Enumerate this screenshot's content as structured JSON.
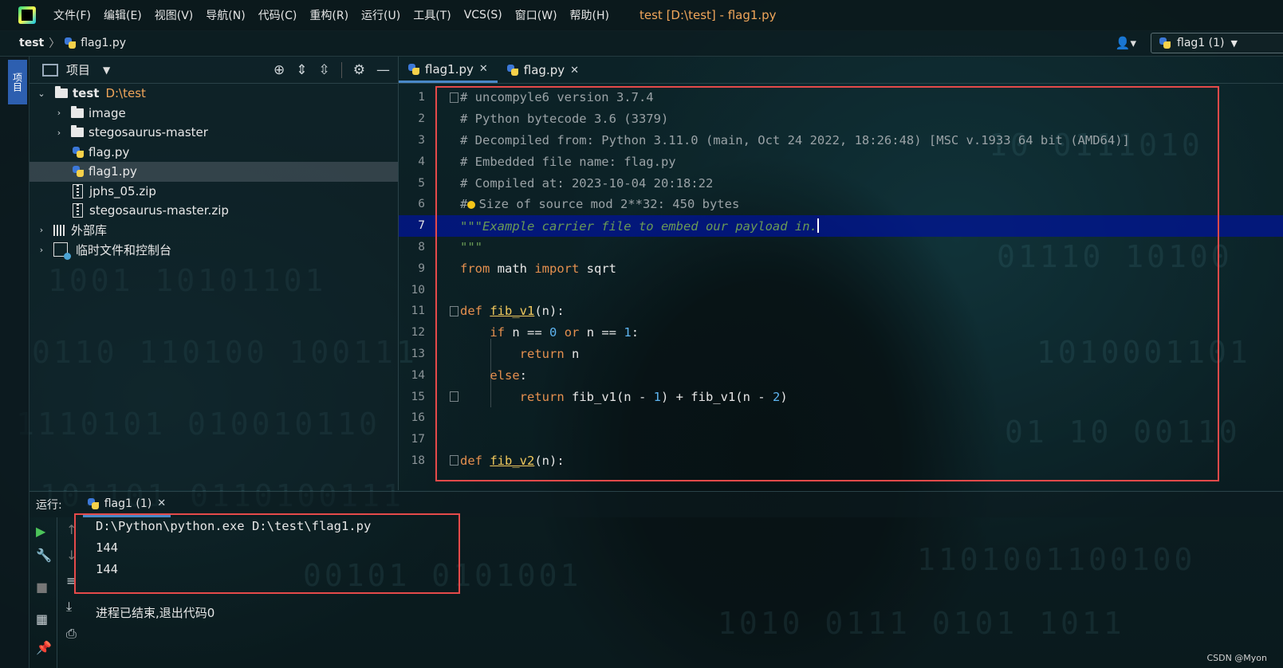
{
  "menubar": {
    "items": [
      "文件(F)",
      "编辑(E)",
      "视图(V)",
      "导航(N)",
      "代码(C)",
      "重构(R)",
      "运行(U)",
      "工具(T)",
      "VCS(S)",
      "窗口(W)",
      "帮助(H)"
    ],
    "window_title": "test [D:\\test] - flag1.py"
  },
  "navbar": {
    "root": "test",
    "file": "flag1.py",
    "run_config": "flag1 (1)"
  },
  "left_stripe": {
    "project_tab": "项目"
  },
  "project_panel": {
    "title": "项目",
    "tree": [
      {
        "label": "test",
        "hint": "D:\\test",
        "type": "root"
      },
      {
        "label": "image",
        "type": "folder"
      },
      {
        "label": "stegosaurus-master",
        "type": "folder"
      },
      {
        "label": "flag.py",
        "type": "py"
      },
      {
        "label": "flag1.py",
        "type": "py",
        "selected": true
      },
      {
        "label": "jphs_05.zip",
        "type": "zip"
      },
      {
        "label": "stegosaurus-master.zip",
        "type": "zip"
      },
      {
        "label": "外部库",
        "type": "lib"
      },
      {
        "label": "临时文件和控制台",
        "type": "scratch"
      }
    ]
  },
  "editor": {
    "tabs": [
      {
        "label": "flag1.py",
        "active": true
      },
      {
        "label": "flag.py",
        "active": false
      }
    ],
    "current_line": 7,
    "lines": [
      {
        "n": "1",
        "code": "# uncompyle6 version 3.7.4"
      },
      {
        "n": "2",
        "code": "# Python bytecode 3.6 (3379)"
      },
      {
        "n": "3",
        "code": "# Decompiled from: Python 3.11.0 (main, Oct 24 2022, 18:26:48) [MSC v.1933 64 bit (AMD64)]"
      },
      {
        "n": "4",
        "code": "# Embedded file name: flag.py"
      },
      {
        "n": "5",
        "code": "# Compiled at: 2023-10-04 20:18:22"
      },
      {
        "n": "6",
        "code": "# Size of source mod 2**32: 450 bytes"
      },
      {
        "n": "7",
        "code": "\"\"\"Example carrier file to embed our payload in."
      },
      {
        "n": "8",
        "code": "\"\"\""
      },
      {
        "n": "9",
        "code": "from math import sqrt"
      },
      {
        "n": "10",
        "code": ""
      },
      {
        "n": "11",
        "code": "def fib_v1(n):"
      },
      {
        "n": "12",
        "code": "    if n == 0 or n == 1:"
      },
      {
        "n": "13",
        "code": "        return n"
      },
      {
        "n": "14",
        "code": "    else:"
      },
      {
        "n": "15",
        "code": "        return fib_v1(n - 1) + fib_v1(n - 2)"
      },
      {
        "n": "16",
        "code": ""
      },
      {
        "n": "17",
        "code": ""
      },
      {
        "n": "18",
        "code": "def fib_v2(n):"
      }
    ]
  },
  "run_panel": {
    "label": "运行:",
    "tab": "flag1 (1)",
    "output": [
      "D:\\Python\\python.exe D:\\test\\flag1.py",
      "144",
      "144",
      "",
      "进程已结束,退出代码0"
    ]
  },
  "watermark": "CSDN @Myon⁠",
  "colors": {
    "keyword": "#e5904f",
    "function": "#f2c95d",
    "number": "#5eb4f0",
    "comment": "#9aa2a6",
    "docstring": "#6a9a55",
    "current_line": "#00148c",
    "highlight_box": "#e64a4a",
    "window_title": "#f0a65a"
  }
}
